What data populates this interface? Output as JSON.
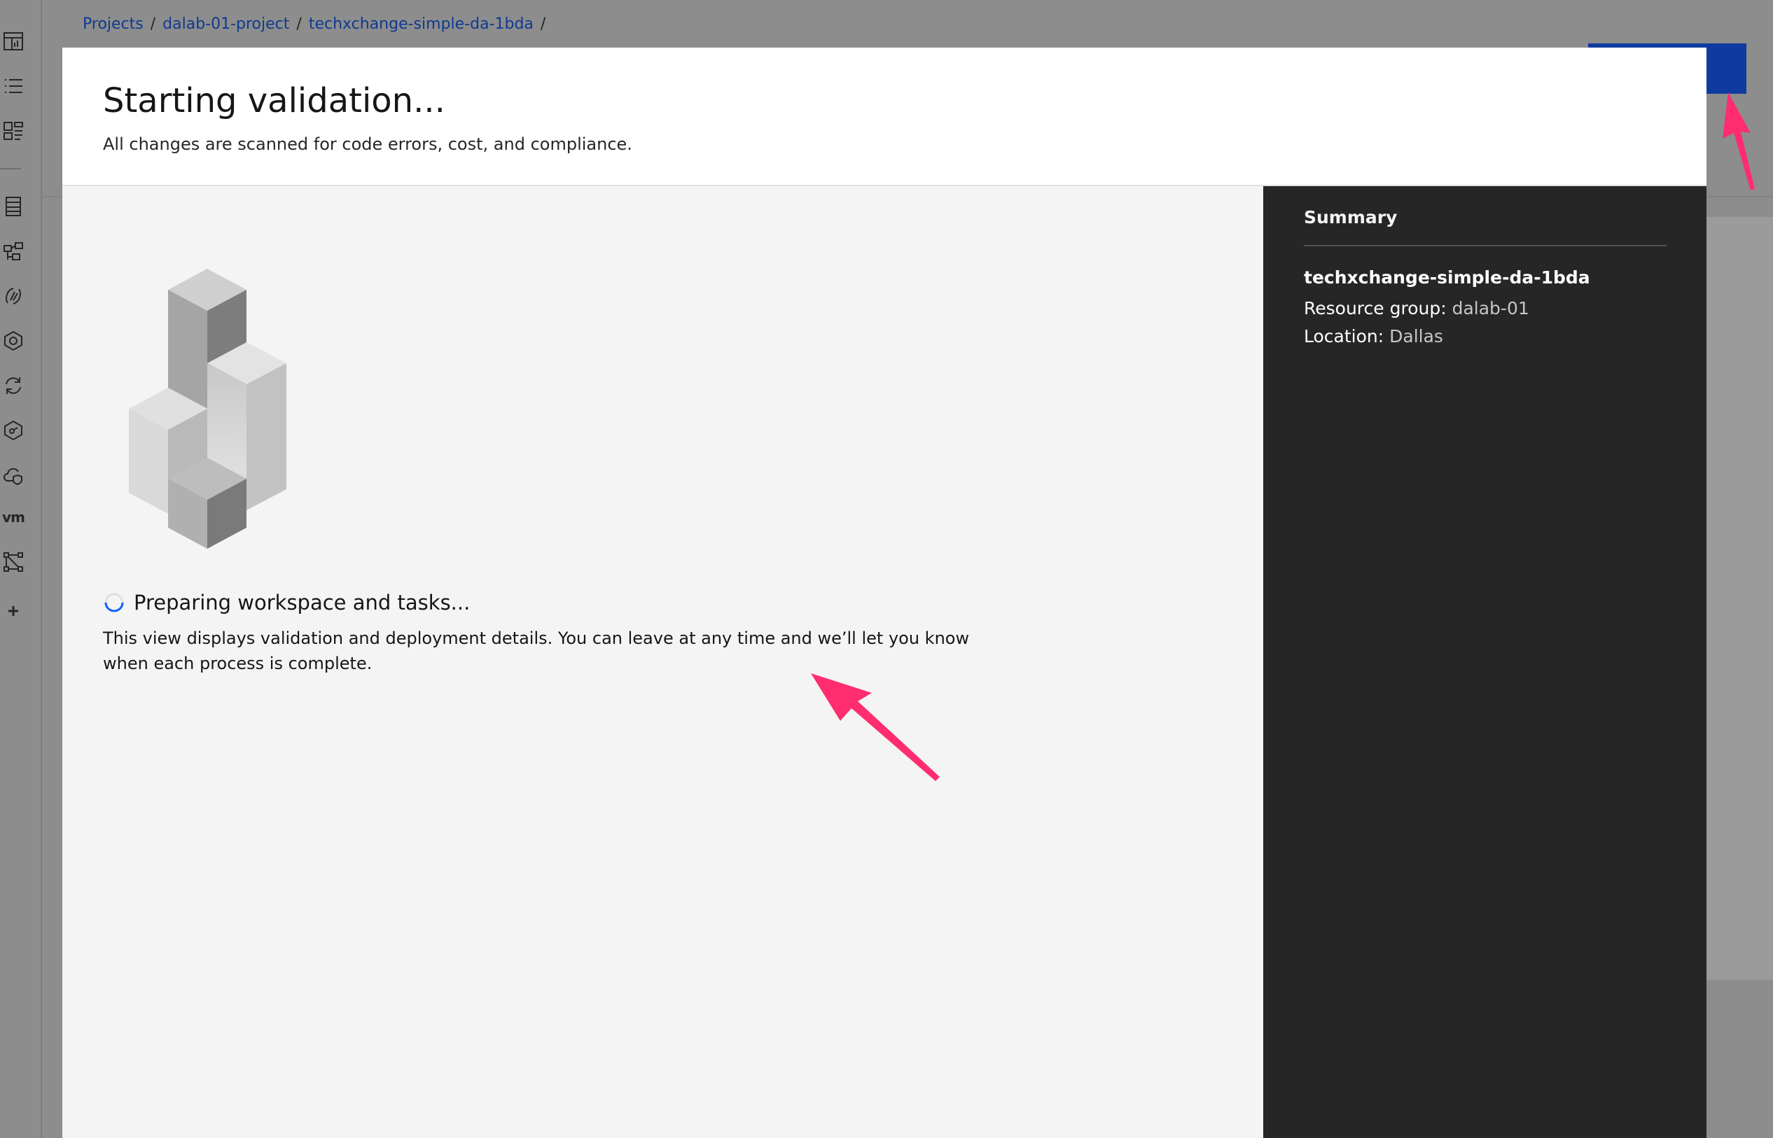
{
  "breadcrumb": {
    "items": [
      "Projects",
      "dalab-01-project",
      "techxchange-simple-da-1bda"
    ],
    "separator": "/"
  },
  "rail": {
    "icons": [
      "dashboard-icon",
      "list-icon",
      "catalog-icon",
      "resource-list-icon",
      "network-icon",
      "functions-icon",
      "kubernetes-icon",
      "refresh-icon",
      "security-icon",
      "cloud-shield-icon",
      "vmware-icon",
      "topology-icon",
      "add-icon"
    ],
    "vm_label": "vm"
  },
  "modal": {
    "title": "Starting validation...",
    "subtitle": "All changes are scanned for code errors, cost, and compliance.",
    "status": "Preparing workspace and tasks...",
    "description": "This view displays validation and deployment details. You can leave at any time and we’ll let you know when each process is complete."
  },
  "summary": {
    "title": "Summary",
    "name": "techxchange-simple-da-1bda",
    "resource_group_label": "Resource group:",
    "resource_group_value": "dalab-01",
    "location_label": "Location:",
    "location_value": "Dallas"
  },
  "colors": {
    "accent": "#0f62fe",
    "annotation": "#ff2d6f",
    "summary_bg": "#262626",
    "overlay": "#8d8d8d"
  }
}
